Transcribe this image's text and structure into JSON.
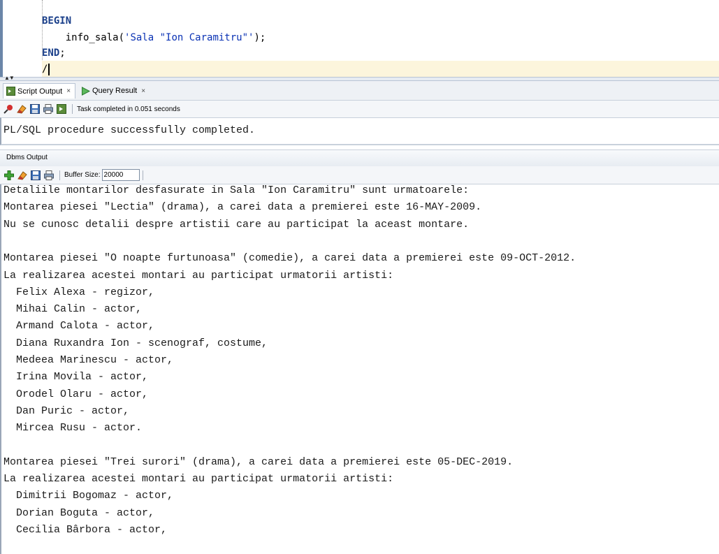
{
  "editor": {
    "lines": [
      {
        "parts": [
          {
            "t": "BEGIN",
            "k": "kw"
          }
        ]
      },
      {
        "parts": [
          {
            "t": "    info_sala(",
            "k": ""
          },
          {
            "t": "'Sala \"Ion Caramitru\"'",
            "k": "str"
          },
          {
            "t": ");",
            "k": ""
          }
        ]
      },
      {
        "parts": [
          {
            "t": "END",
            "k": "kw"
          },
          {
            "t": ";",
            "k": ""
          }
        ]
      },
      {
        "parts": [
          {
            "t": "/",
            "k": ""
          }
        ]
      }
    ]
  },
  "tabs": {
    "script_output": "Script Output",
    "query_result": "Query Result",
    "close_glyph": "×"
  },
  "script_toolbar": {
    "status": "Task completed in 0.051 seconds"
  },
  "script_output": {
    "text": "PL/SQL procedure successfully completed."
  },
  "dbms": {
    "title": "Dbms Output",
    "buffer_label": "Buffer Size:",
    "buffer_value": "20000",
    "lines": [
      "Detaliile montarilor desfasurate in Sala \"Ion Caramitru\" sunt urmatoarele:",
      "Montarea piesei \"Lectia\" (drama), a carei data a premierei este 16-MAY-2009.",
      "Nu se cunosc detalii despre artistii care au participat la aceast montare.",
      "",
      "Montarea piesei \"O noapte furtunoasa\" (comedie), a carei data a premierei este 09-OCT-2012.",
      "La realizarea acestei montari au participat urmatorii artisti:",
      "  Felix Alexa - regizor,",
      "  Mihai Calin - actor,",
      "  Armand Calota - actor,",
      "  Diana Ruxandra Ion - scenograf, costume,",
      "  Medeea Marinescu - actor,",
      "  Irina Movila - actor,",
      "  Orodel Olaru - actor,",
      "  Dan Puric - actor,",
      "  Mircea Rusu - actor.",
      "",
      "Montarea piesei \"Trei surori\" (drama), a carei data a premierei este 05-DEC-2019.",
      "La realizarea acestei montari au participat urmatorii artisti:",
      "  Dimitrii Bogomaz - actor,",
      "  Dorian Boguta - actor,",
      "  Cecilia Bârbora - actor,"
    ]
  },
  "colors": {
    "keyword": "#1a3f8a",
    "string": "#0a32b4",
    "current_line": "#fcf5dc"
  }
}
